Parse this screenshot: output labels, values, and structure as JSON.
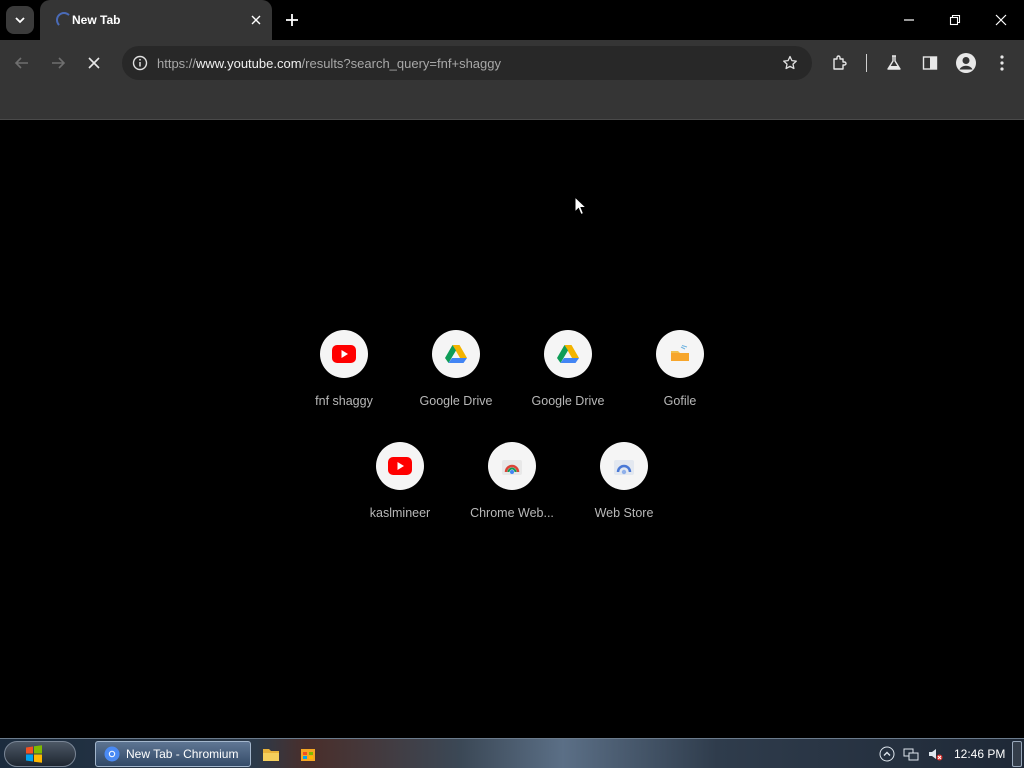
{
  "window": {
    "tab_title": "New Tab",
    "address": {
      "scheme": "https://",
      "host": "www.youtube.com",
      "path": "/results?search_query=fnf+shaggy"
    }
  },
  "shortcuts": [
    {
      "label": "fnf shaggy",
      "icon": "youtube-icon"
    },
    {
      "label": "Google Drive",
      "icon": "google-drive-icon"
    },
    {
      "label": "Google Drive",
      "icon": "google-drive-icon"
    },
    {
      "label": "Gofile",
      "icon": "gofile-icon"
    },
    {
      "label": "kaslmineer",
      "icon": "youtube-icon"
    },
    {
      "label": "Chrome Web...",
      "icon": "chrome-web-store-icon"
    },
    {
      "label": "Web Store",
      "icon": "web-store-icon"
    }
  ],
  "taskbar": {
    "active_window": "New Tab - Chromium",
    "clock": "12:46 PM"
  },
  "colors": {
    "youtube_red": "#ff0000",
    "drive_blue": "#4285f4",
    "drive_green": "#0f9d58",
    "drive_yellow": "#f4b400"
  }
}
